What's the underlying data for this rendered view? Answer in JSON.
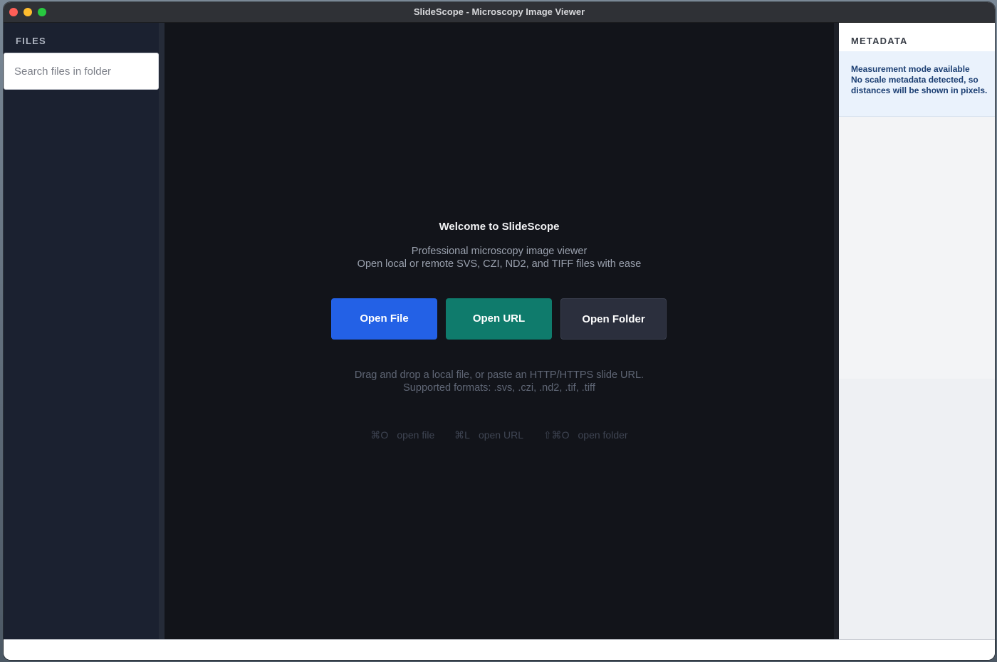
{
  "window": {
    "title": "SlideScope - Microscopy Image Viewer"
  },
  "sidebar": {
    "title": "FILES",
    "search_placeholder": "Search files in folder"
  },
  "main": {
    "welcome": "Welcome to SlideScope",
    "subtitle_line1": "Professional microscopy image viewer",
    "subtitle_line2": "Open local or remote SVS, CZI, ND2, and TIFF files with ease",
    "buttons": {
      "open_file": "Open File",
      "open_url": "Open URL",
      "open_folder": "Open Folder"
    },
    "hint_line1": "Drag and drop a local file, or paste an HTTP/HTTPS slide URL.",
    "hint_line2": "Supported formats: .svs, .czi, .nd2, .tif, .tiff",
    "shortcuts": [
      {
        "keys": "⌘O",
        "label": "open file"
      },
      {
        "keys": "⌘L",
        "label": "open URL"
      },
      {
        "keys": "⇧⌘O",
        "label": "open folder"
      }
    ]
  },
  "metadata": {
    "title": "METADATA",
    "notice_title": "Measurement mode available",
    "notice_body": "No scale metadata detected, so distances will be shown in pixels."
  },
  "colors": {
    "accent_blue": "#2361e6",
    "accent_teal": "#0f7b6c",
    "panel_dark": "#12141a"
  }
}
